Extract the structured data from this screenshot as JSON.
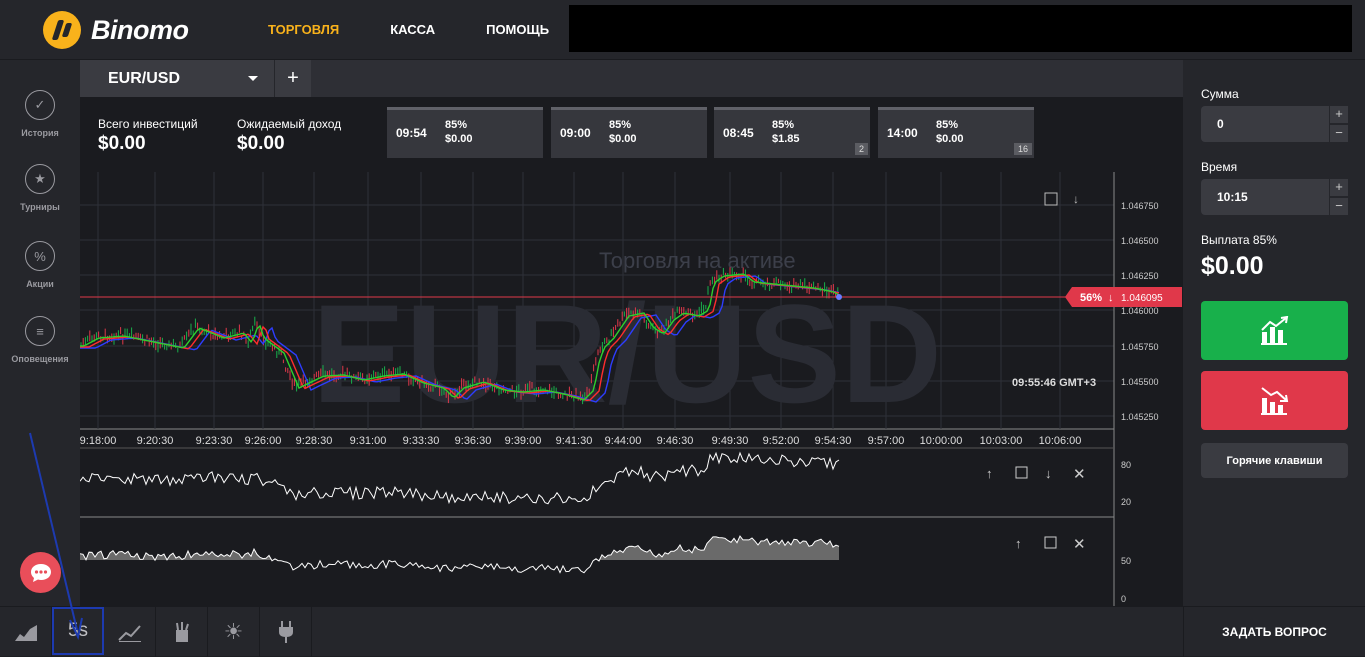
{
  "header": {
    "logo_text": "Binomo",
    "nav": [
      {
        "label": "ТОРГОВЛЯ",
        "active": true
      },
      {
        "label": "КАССА",
        "active": false
      },
      {
        "label": "ПОМОЩЬ",
        "active": false
      }
    ]
  },
  "sidebar": {
    "items": [
      {
        "label": "История",
        "icon": "check-circle-icon"
      },
      {
        "label": "Турниры",
        "icon": "trophy-icon"
      },
      {
        "label": "Акции",
        "icon": "percent-icon"
      },
      {
        "label": "Оповещения",
        "icon": "menu-icon"
      }
    ]
  },
  "tabs": {
    "asset": "EUR/USD",
    "add": "+"
  },
  "investments": {
    "total_label": "Всего инвестиций",
    "total_value": "$0.00",
    "expected_label": "Ожидаемый доход",
    "expected_value": "$0.00"
  },
  "deals": [
    {
      "time": "09:54",
      "percent": "85%",
      "amount": "$0.00",
      "count": ""
    },
    {
      "time": "09:00",
      "percent": "85%",
      "amount": "$0.00",
      "count": ""
    },
    {
      "time": "08:45",
      "percent": "85%",
      "amount": "$1.85",
      "count": "2"
    },
    {
      "time": "14:00",
      "percent": "85%",
      "amount": "$0.00",
      "count": "16"
    }
  ],
  "chart": {
    "watermark_sub": "Торговля на активе",
    "watermark_main": "EUR/USD",
    "price_tag_pct": "56%",
    "price_tag_value": "1.046095",
    "server_time": "09:55:46 GMT+3",
    "y_ticks": [
      "1.046750",
      "1.046500",
      "1.046250",
      "1.046000",
      "1.045750",
      "1.045500",
      "1.045250"
    ],
    "x_ticks": [
      "9:18:00",
      "9:20:30",
      "9:23:30",
      "9:26:00",
      "9:28:30",
      "9:31:00",
      "9:33:30",
      "9:36:30",
      "9:39:00",
      "9:41:30",
      "9:44:00",
      "9:46:30",
      "9:49:30",
      "9:52:00",
      "9:54:30",
      "9:57:00",
      "10:00:00",
      "10:03:00",
      "10:06:00"
    ],
    "osc1_ticks": [
      "80",
      "20"
    ],
    "osc2_ticks": [
      "50",
      "0"
    ],
    "colors": {
      "up": "#18b04b",
      "down": "#e0384a",
      "accent": "#f9b21b",
      "price_line": "#e0384a",
      "ma_red": "#ff2d2d",
      "ma_green": "#2dd12d",
      "ma_blue": "#2d3dff"
    }
  },
  "right_panel": {
    "amount_label": "Сумма",
    "amount_value": "0",
    "time_label": "Время",
    "time_value": "10:15",
    "payout_label": "Выплата 85%",
    "payout_value": "$0.00",
    "hotkeys_label": "Горячие клавиши",
    "plus": "+",
    "minus": "−"
  },
  "bottom": {
    "timeframe": "5s",
    "ask_label": "ЗАДАТЬ ВОПРОС"
  }
}
